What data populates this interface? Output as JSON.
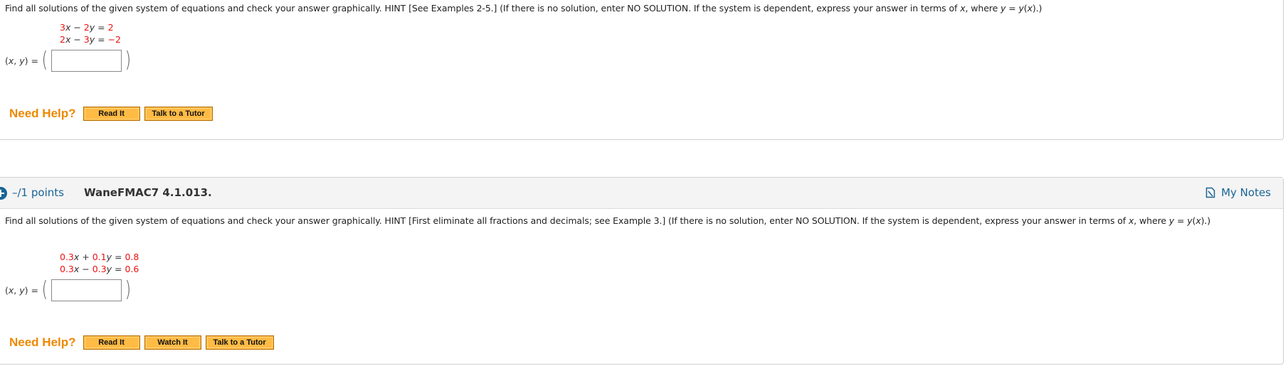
{
  "question1": {
    "prompt_parts": [
      {
        "t": "Find all solutions of the given system of equations and check your answer graphically. HINT [See Examples 2-5.] (If there is no solution, enter NO SOLUTION. If the system is dependent, express your answer in terms of "
      },
      {
        "t": "x",
        "i": true
      },
      {
        "t": ", where "
      },
      {
        "t": "y",
        "i": true
      },
      {
        "t": " = "
      },
      {
        "t": "y",
        "i": true
      },
      {
        "t": "("
      },
      {
        "t": "x",
        "i": true
      },
      {
        "t": ").)"
      }
    ],
    "equations": [
      [
        {
          "t": "3",
          "r": true
        },
        {
          "t": "x",
          "i": true
        },
        {
          "t": " − "
        },
        {
          "t": "2",
          "r": true
        },
        {
          "t": "y",
          "i": true
        },
        {
          "t": " = "
        },
        {
          "t": "2",
          "r": true
        }
      ],
      [
        {
          "t": "2",
          "r": true
        },
        {
          "t": "x",
          "i": true
        },
        {
          "t": " − "
        },
        {
          "t": "3",
          "r": true
        },
        {
          "t": "y",
          "i": true
        },
        {
          "t": " = "
        },
        {
          "t": "−2",
          "r": true
        }
      ]
    ],
    "answer_label": "(x, y) =",
    "answer_value": "",
    "need_help_label": "Need Help?",
    "help_buttons": [
      "Read It",
      "Talk to a Tutor"
    ]
  },
  "question2": {
    "points": "–/1 points",
    "id": "WaneFMAC7 4.1.013.",
    "my_notes_label": "My Notes",
    "prompt_parts": [
      {
        "t": "Find all solutions of the given system of equations and check your answer graphically. HINT [First eliminate all fractions and decimals; see Example 3.] (If there is no solution, enter NO SOLUTION. If the system is dependent, express your answer in terms of "
      },
      {
        "t": "x",
        "i": true
      },
      {
        "t": ", where "
      },
      {
        "t": "y",
        "i": true
      },
      {
        "t": " = "
      },
      {
        "t": "y",
        "i": true
      },
      {
        "t": "("
      },
      {
        "t": "x",
        "i": true
      },
      {
        "t": ").)"
      }
    ],
    "equations": [
      [
        {
          "t": "0.3",
          "r": true
        },
        {
          "t": "x",
          "i": true
        },
        {
          "t": " + "
        },
        {
          "t": "0.1",
          "r": true
        },
        {
          "t": "y",
          "i": true
        },
        {
          "t": " = "
        },
        {
          "t": "0.8",
          "r": true
        }
      ],
      [
        {
          "t": "0.3",
          "r": true
        },
        {
          "t": "x",
          "i": true
        },
        {
          "t": " − "
        },
        {
          "t": "0.3",
          "r": true
        },
        {
          "t": "y",
          "i": true
        },
        {
          "t": " = "
        },
        {
          "t": "0.6",
          "r": true
        }
      ]
    ],
    "answer_label": "(x, y) =",
    "answer_value": "",
    "need_help_label": "Need Help?",
    "help_buttons": [
      "Read It",
      "Watch It",
      "Talk to a Tutor"
    ]
  },
  "colors": {
    "accent_blue": "#1a6496",
    "coefficient_red": "#ee1111",
    "need_help_orange": "#ee8800",
    "button_fill": "#ffbb44"
  }
}
